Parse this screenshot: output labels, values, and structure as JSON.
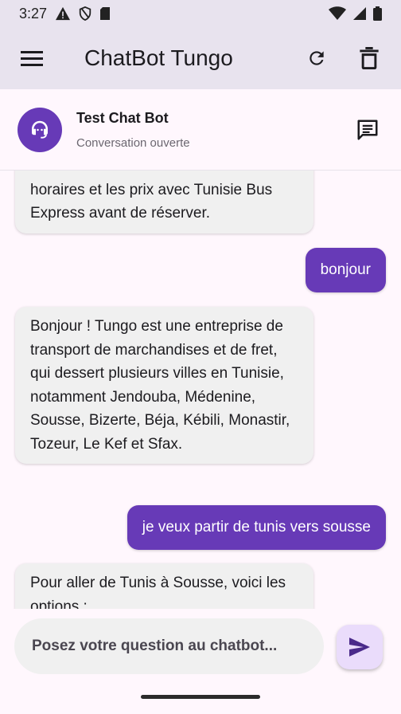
{
  "status_bar": {
    "time": "3:27"
  },
  "app_bar": {
    "title": "ChatBot Tungo",
    "refresh_icon": "refresh-icon",
    "delete_icon": "delete-icon",
    "menu_icon": "menu-icon"
  },
  "chat_header": {
    "name": "Test Chat Bot",
    "status": "Conversation ouverte",
    "avatar_icon": "support-agent-icon",
    "chat_icon": "chat-icon"
  },
  "messages": [
    {
      "sender": "bot",
      "text": "Il est recommandé de vérifier les horaires et les prix avec Tunisie Bus Express avant de réserver."
    },
    {
      "sender": "user",
      "text": "bonjour"
    },
    {
      "sender": "bot",
      "text": "Bonjour ! Tungo est une entreprise de transport de marchandises et de fret, qui dessert plusieurs villes en Tunisie, notamment Jendouba, Médenine, Sousse, Bizerte, Béja, Kébili, Monastir, Tozeur, Le Kef et Sfax."
    },
    {
      "sender": "user",
      "text": "je veux partir de tunis vers sousse"
    },
    {
      "sender": "bot",
      "text": "Pour aller de Tunis à Sousse, voici les options :"
    }
  ],
  "input": {
    "placeholder": "Posez votre question au chatbot..."
  },
  "colors": {
    "primary": "#673ab7",
    "app_bar": "#e8e3ee",
    "bot_bubble": "#f0f0f0",
    "send_button": "#eadcfb"
  }
}
